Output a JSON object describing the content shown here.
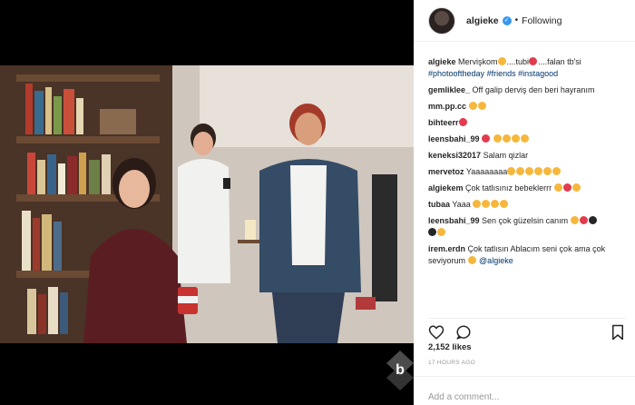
{
  "header": {
    "username": "algieke",
    "follow_state": "Following",
    "dot": "•"
  },
  "comments": [
    {
      "user": "algieke",
      "text": " Mervişkom",
      "tail": "....tubi",
      "tail2": "....falan tb'si",
      "tags": [
        "#photooftheday",
        "#friends",
        "#instagood"
      ]
    },
    {
      "user": "gemliklee_",
      "text": " Off galip derviş den beri hayranım"
    },
    {
      "user": "mm.pp.cc",
      "text": " "
    },
    {
      "user": "bihteerr",
      "text": ""
    },
    {
      "user": "leensbahi_99",
      "text": " "
    },
    {
      "user": "keneksi32017",
      "text": " Salam qizlar"
    },
    {
      "user": "mervetoz",
      "text": " Yaaaaaaaa"
    },
    {
      "user": "algiekem",
      "text": " Çok tatlısınız bebeklerrr"
    },
    {
      "user": "tubaa",
      "text": " Yaaa"
    },
    {
      "user": "leensbahi_99",
      "text": " Sen çok güzelsin canım"
    },
    {
      "user": "irem.erdn",
      "text": " Çok tatlısın Ablacım seni çok ama çok seviyorum",
      "mention": "@algieke"
    }
  ],
  "stats": {
    "likes": "2,152 likes",
    "time": "17 HOURS AGO"
  },
  "add_comment": {
    "placeholder": "Add a comment..."
  },
  "icons": {
    "like": "heart-icon",
    "comment": "comment-icon",
    "save": "bookmark-icon",
    "verified": "verified-badge-icon"
  },
  "colors": {
    "verified": "#3897f0",
    "hashtag": "#003569",
    "muted": "#999999"
  }
}
